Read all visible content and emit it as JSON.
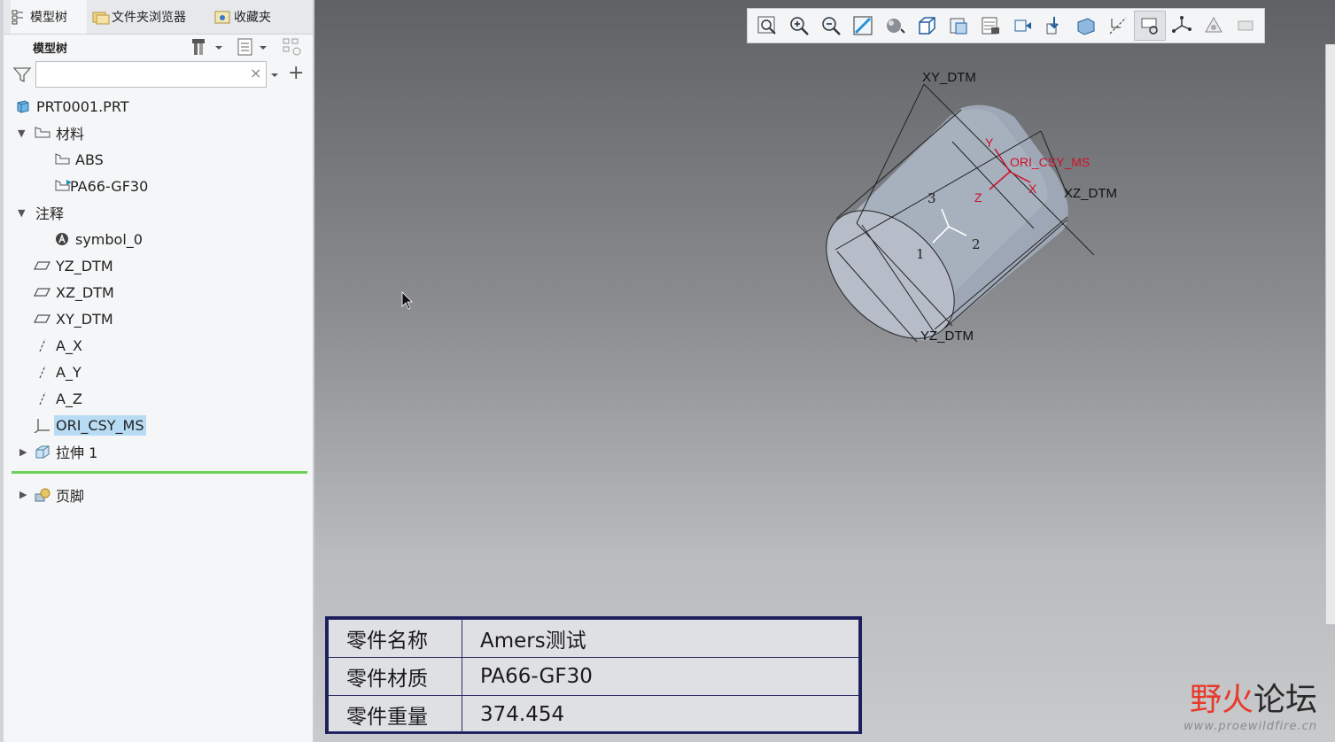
{
  "tabs": [
    {
      "label": "模型树",
      "icon": "model-tree-icon"
    },
    {
      "label": "文件夹浏览器",
      "icon": "folder-browser-icon"
    },
    {
      "label": "收藏夹",
      "icon": "favorites-icon"
    }
  ],
  "tree_header": {
    "title": "模型树"
  },
  "search": {
    "placeholder": "",
    "value": ""
  },
  "tree": [
    {
      "label": "PRT0001.PRT",
      "icon": "part-icon"
    },
    {
      "label": "材料",
      "icon": "material-folder-icon"
    },
    {
      "label": "ABS",
      "icon": "material-icon"
    },
    {
      "label": "PA66-GF30",
      "icon": "material-assigned-icon"
    },
    {
      "label": "注释",
      "icon": "annotation-folder-icon"
    },
    {
      "label": "symbol_0",
      "icon": "symbol-icon"
    },
    {
      "label": "YZ_DTM",
      "icon": "datum-plane-icon"
    },
    {
      "label": "XZ_DTM",
      "icon": "datum-plane-icon"
    },
    {
      "label": "XY_DTM",
      "icon": "datum-plane-icon"
    },
    {
      "label": "A_X",
      "icon": "datum-axis-icon"
    },
    {
      "label": "A_Y",
      "icon": "datum-axis-icon"
    },
    {
      "label": "A_Z",
      "icon": "datum-axis-icon"
    },
    {
      "label": "ORI_CSY_MS",
      "icon": "coordinate-system-icon"
    },
    {
      "label": "拉伸 1",
      "icon": "extrude-icon"
    },
    {
      "label": "页脚",
      "icon": "footer-icon"
    }
  ],
  "view_toolbar": [
    "refit-icon",
    "zoom-in-icon",
    "zoom-out-icon",
    "repaint-icon",
    "shading-icon",
    "view-orientation-icon",
    "saved-views-icon",
    "view-manager-icon",
    "perspective-icon",
    "spin-center-icon",
    "datum-display-icon",
    "annotation-display-icon",
    "selection-filter-icon",
    "csys-display-icon",
    "model-display-icon",
    "more-icon"
  ],
  "model_labels": {
    "xy_dtm": "XY_DTM",
    "xz_dtm": "XZ_DTM",
    "yz_dtm": "YZ_DTM",
    "csys": "ORI_CSY_MS",
    "csys_x": "X",
    "csys_y": "Y",
    "csys_z": "Z",
    "triad_1": "1",
    "triad_2": "2",
    "triad_3": "3"
  },
  "info_table": [
    {
      "key": "零件名称",
      "value": "Amers测试"
    },
    {
      "key": "零件材质",
      "value": "PA66-GF30"
    },
    {
      "key": "零件重量",
      "value": "374.454"
    }
  ],
  "watermark": {
    "logo_a": "野火",
    "logo_b": "论坛",
    "url": "www.proewildfire.cn"
  },
  "colors": {
    "selection": "#b9dcf5",
    "csys_red": "#d0102a",
    "table_border": "#1c1d5c",
    "divider_green": "#6fd05a"
  }
}
